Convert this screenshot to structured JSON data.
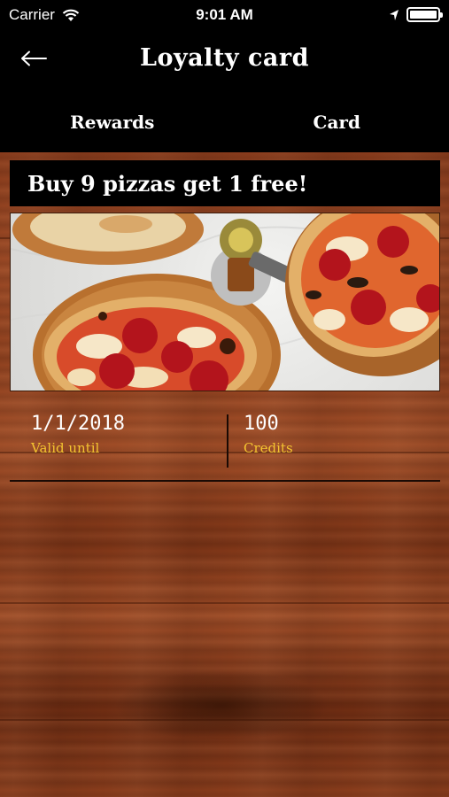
{
  "status_bar": {
    "carrier": "Carrier",
    "time": "9:01 AM",
    "icons": [
      "wifi-icon",
      "location-arrow-icon",
      "battery-icon"
    ]
  },
  "nav": {
    "title": "Loyalty card",
    "back_icon": "back-arrow-icon"
  },
  "tabs": [
    {
      "label": "Rewards"
    },
    {
      "label": "Card"
    }
  ],
  "card": {
    "promo": "Buy 9 pizzas get 1 free!",
    "image": "pizza-photo",
    "valid_until_value": "1/1/2018",
    "valid_until_label": "Valid until",
    "credits_value": "100",
    "credits_label": "Credits"
  },
  "colors": {
    "header_bg": "#000000",
    "label_accent": "#f4c430",
    "wood": "#8a3c1c"
  }
}
